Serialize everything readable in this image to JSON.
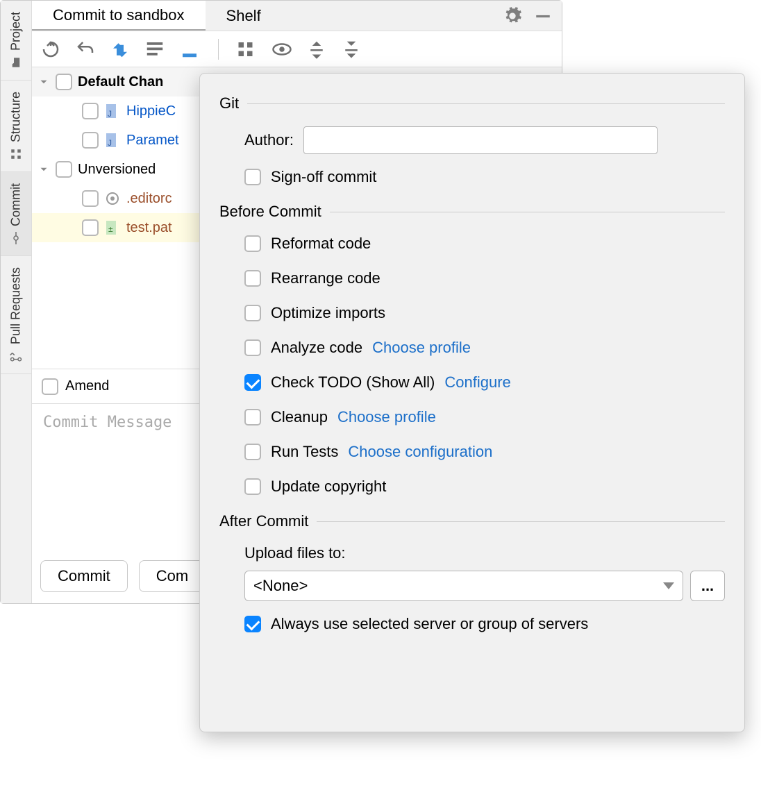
{
  "tabs": {
    "commit": "Commit to sandbox",
    "shelf": "Shelf"
  },
  "left_tabs": {
    "project": "Project",
    "structure": "Structure",
    "commit": "Commit",
    "pull_requests": "Pull Requests"
  },
  "tree": {
    "default_changelist": "Default Chan",
    "file1": "HippieC",
    "file2": "Paramet",
    "unversioned": "Unversioned ",
    "file3": ".editorc",
    "file4": "test.pat"
  },
  "amend": {
    "label": "Amend"
  },
  "commit_msg_placeholder": "Commit Message",
  "buttons": {
    "commit": "Commit",
    "commit_and": "Com"
  },
  "popup": {
    "git": {
      "title": "Git",
      "author_label": "Author:",
      "author_value": "",
      "signoff": "Sign-off commit"
    },
    "before": {
      "title": "Before Commit",
      "reformat": "Reformat code",
      "rearrange": "Rearrange code",
      "optimize": "Optimize imports",
      "analyze": "Analyze code",
      "analyze_link": "Choose profile",
      "check_todo": "Check TODO (Show All)",
      "check_todo_link": "Configure",
      "cleanup": "Cleanup",
      "cleanup_link": "Choose profile",
      "run_tests": "Run Tests",
      "run_tests_link": "Choose configuration",
      "update_copyright": "Update copyright"
    },
    "after": {
      "title": "After Commit",
      "upload_label": "Upload files to:",
      "upload_value": "<None>",
      "browse": "...",
      "always_use": "Always use selected server or group of servers"
    }
  }
}
